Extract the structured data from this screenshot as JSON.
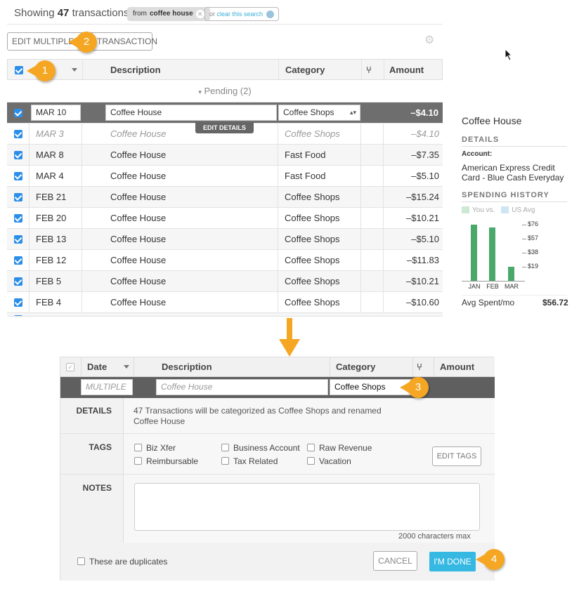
{
  "header": {
    "showing_prefix": "Showing",
    "count": "47",
    "showing_suffix": "transactions",
    "filter_from": "from",
    "filter_value": "coffee house",
    "clear_prefix": "or",
    "clear_link": "clear this search"
  },
  "toolbar": {
    "edit_multiple": "EDIT MULTIPLE",
    "add_transaction": "TRANSACTION"
  },
  "table": {
    "headers": {
      "date": "",
      "description": "Description",
      "category": "Category",
      "amount": "Amount"
    },
    "pending_label": "Pending (2)",
    "edit_details": "EDIT DETAILS",
    "selected": {
      "date": "MAR 10",
      "description": "Coffee House",
      "category": "Coffee Shops",
      "amount": "–$4.10"
    },
    "rows": [
      {
        "date": "MAR 3",
        "description": "Coffee House",
        "category": "Coffee Shops",
        "amount": "–$4.10",
        "pending": true
      },
      {
        "date": "MAR 8",
        "description": "Coffee House",
        "category": "Fast Food",
        "amount": "–$7.35"
      },
      {
        "date": "MAR 4",
        "description": "Coffee House",
        "category": "Fast Food",
        "amount": "–$5.10"
      },
      {
        "date": "FEB 21",
        "description": "Coffee House",
        "category": "Coffee Shops",
        "amount": "–$15.24"
      },
      {
        "date": "FEB 20",
        "description": "Coffee House",
        "category": "Coffee Shops",
        "amount": "–$10.21"
      },
      {
        "date": "FEB 13",
        "description": "Coffee House",
        "category": "Coffee Shops",
        "amount": "–$5.10"
      },
      {
        "date": "FEB 12",
        "description": "Coffee House",
        "category": "Coffee Shops",
        "amount": "–$11.83"
      },
      {
        "date": "FEB 5",
        "description": "Coffee House",
        "category": "Coffee Shops",
        "amount": "–$10.21"
      },
      {
        "date": "FEB 4",
        "description": "Coffee House",
        "category": "Coffee Shops",
        "amount": "–$10.60"
      }
    ]
  },
  "badges": {
    "one": "1",
    "two": "2",
    "three": "3",
    "four": "4"
  },
  "details_panel": {
    "title": "Coffee House",
    "details_heading": "DETAILS",
    "account_label": "Account:",
    "account_value": "American Express Credit Card - Blue Cash Everyday",
    "spending_heading": "SPENDING HISTORY",
    "legend_you": "You vs.",
    "legend_us": "US Avg",
    "avg_label": "Avg Spent/mo",
    "avg_value": "$56.72",
    "colors": {
      "you": "#4aa86a",
      "us_avg": "#cce6f4"
    }
  },
  "chart_data": {
    "type": "bar",
    "categories": [
      "JAN",
      "FEB",
      "MAR"
    ],
    "series": [
      {
        "name": "You",
        "values": [
          76,
          72,
          19
        ]
      }
    ],
    "y_ticks": [
      "$76",
      "$57",
      "$38",
      "$19"
    ],
    "ylim": [
      0,
      80
    ]
  },
  "editor": {
    "headers": {
      "date": "Date",
      "description": "Description",
      "category": "Category",
      "amount": "Amount"
    },
    "date_value": "MULTIPLE",
    "description_value": "Coffee House",
    "category_value": "Coffee Shops",
    "details_label": "DETAILS",
    "details_text_1": "47 Transactions will be categorized as Coffee Shops and renamed",
    "details_text_2": "Coffee House",
    "tags_label": "TAGS",
    "tags": [
      "Biz Xfer",
      "Business Account",
      "Raw Revenue",
      "Reimbursable",
      "Tax Related",
      "Vacation"
    ],
    "edit_tags": "EDIT TAGS",
    "notes_label": "NOTES",
    "notes_max": "2000 characters max",
    "duplicates_label": "These are duplicates",
    "cancel": "CANCEL",
    "done": "I'M DONE"
  }
}
